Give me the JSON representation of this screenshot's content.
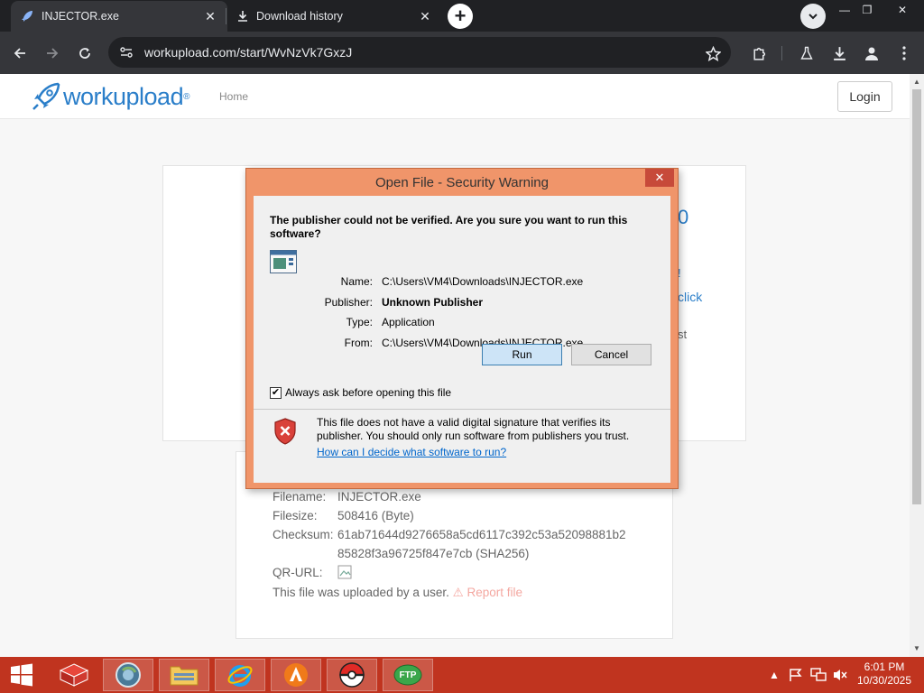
{
  "browser": {
    "tabs": [
      {
        "label": "INJECTOR.exe",
        "active": true,
        "icon": "rocket-icon"
      },
      {
        "label": "Download history",
        "active": false,
        "icon": "download-icon"
      }
    ],
    "url": "workupload.com/start/WvNzVk7GxzJ"
  },
  "site": {
    "logo_text": "workupload",
    "logo_mark": "®",
    "nav_home": "Home",
    "login_label": "Login"
  },
  "peek": {
    "right_num": "0",
    "exclaim": "!",
    "click": "click",
    "st": "st"
  },
  "file_info": {
    "filename_label": "Filename:",
    "filename": "INJECTOR.exe",
    "filesize_label": "Filesize:",
    "filesize": "508416 (Byte)",
    "checksum_label": "Checksum:",
    "checksum_line1": "61ab71644d9276658a5cd6117c392c53a52098881b2",
    "checksum_line2": "85828f3a96725f847e7cb (SHA256)",
    "qr_label": "QR-URL:",
    "uploaded_text": "This file was uploaded by a user.",
    "report_label": "Report file"
  },
  "dialog": {
    "title": "Open File - Security Warning",
    "question": "The publisher could not be verified.  Are you sure you want to run this software?",
    "name_label": "Name:",
    "name_value": "C:\\Users\\VM4\\Downloads\\INJECTOR.exe",
    "publisher_label": "Publisher:",
    "publisher_value": "Unknown Publisher",
    "type_label": "Type:",
    "type_value": "Application",
    "from_label": "From:",
    "from_value": "C:\\Users\\VM4\\Downloads\\INJECTOR.exe",
    "run_label": "Run",
    "cancel_label": "Cancel",
    "checkbox_label": "Always ask before opening this file",
    "checkbox_checked": true,
    "warning_text": "This file does not have a valid digital signature that verifies its publisher.  You should only run software from publishers you trust.",
    "help_link": "How can I decide what software to run?"
  },
  "taskbar": {
    "time": "6:01 PM",
    "date": "10/30/2025",
    "ftp_label": "FTP",
    "accent": "#c0341f"
  }
}
